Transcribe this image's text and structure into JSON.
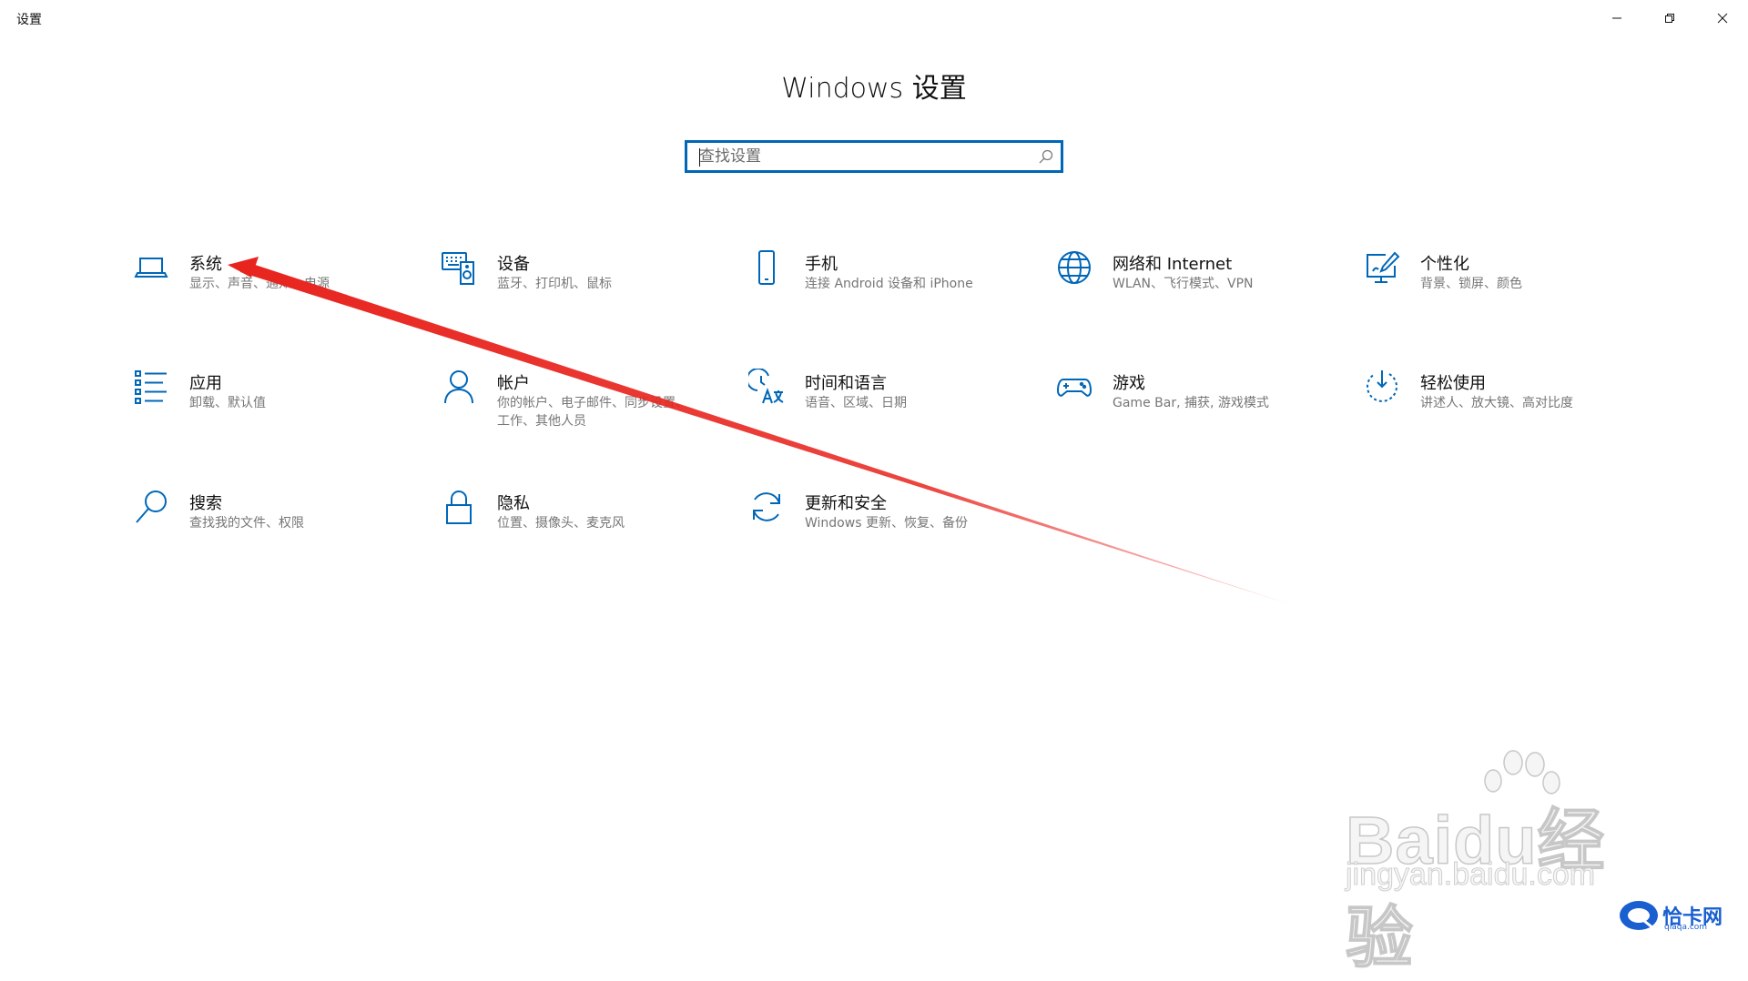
{
  "window": {
    "title": "设置",
    "controls": [
      "minimize",
      "restore",
      "close"
    ]
  },
  "page": {
    "title": "Windows 设置"
  },
  "search": {
    "placeholder": "查找设置",
    "value": ""
  },
  "colors": {
    "accent": "#0067b8",
    "text": "#111111",
    "secondary_text": "#767676",
    "annotation_arrow": "#e8241e"
  },
  "tiles": [
    {
      "label": "系统",
      "desc": "显示、声音、通知、电源",
      "icon": "laptop-icon"
    },
    {
      "label": "设备",
      "desc": "蓝牙、打印机、鼠标",
      "icon": "devices-icon"
    },
    {
      "label": "手机",
      "desc": "连接 Android 设备和 iPhone",
      "icon": "phone-icon"
    },
    {
      "label": "网络和 Internet",
      "desc": "WLAN、飞行模式、VPN",
      "icon": "globe-icon"
    },
    {
      "label": "个性化",
      "desc": "背景、锁屏、颜色",
      "icon": "personalization-icon"
    },
    {
      "label": "应用",
      "desc": "卸载、默认值",
      "icon": "apps-list-icon"
    },
    {
      "label": "帐户",
      "desc": "你的帐户、电子邮件、同步设置、工作、其他人员",
      "icon": "person-icon"
    },
    {
      "label": "时间和语言",
      "desc": "语音、区域、日期",
      "icon": "time-language-icon"
    },
    {
      "label": "游戏",
      "desc": "Game Bar, 捕获, 游戏模式",
      "icon": "gamepad-icon"
    },
    {
      "label": "轻松使用",
      "desc": "讲述人、放大镜、高对比度",
      "icon": "ease-of-access-icon"
    },
    {
      "label": "搜索",
      "desc": "查找我的文件、权限",
      "icon": "search-magnifier-icon"
    },
    {
      "label": "隐私",
      "desc": "位置、摄像头、麦克风",
      "icon": "lock-icon"
    },
    {
      "label": "更新和安全",
      "desc": "Windows 更新、恢复、备份",
      "icon": "sync-icon"
    }
  ],
  "watermark": {
    "brand": "Baidu经验",
    "url": "jingyan.baidu.com"
  },
  "badge": {
    "text": "恰卡网",
    "sub": "qiaqa.com"
  }
}
